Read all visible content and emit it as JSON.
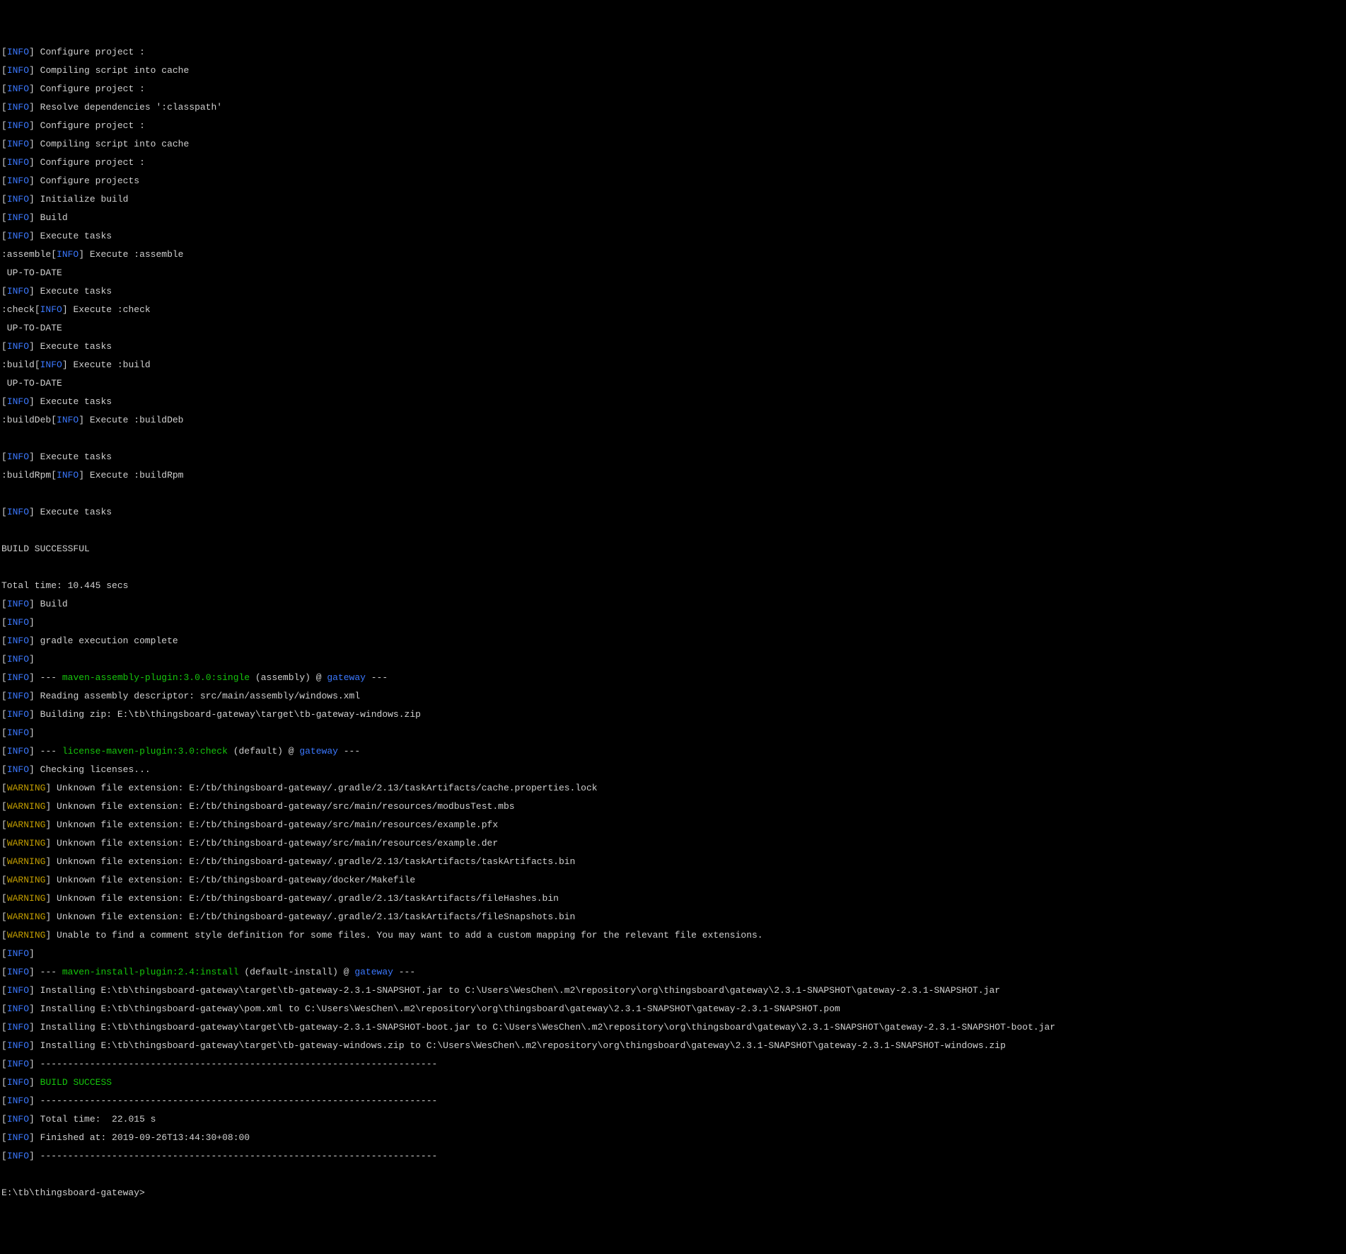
{
  "tags": {
    "info": "INFO",
    "warning": "WARNING"
  },
  "lines": {
    "l01": " Configure project :",
    "l02": " Compiling script into cache",
    "l03": " Configure project :",
    "l04": " Resolve dependencies ':classpath'",
    "l05": " Configure project :",
    "l06": " Compiling script into cache",
    "l07": " Configure project :",
    "l08": " Configure projects",
    "l09": " Initialize build",
    "l10": " Build",
    "l11": " Execute tasks",
    "l12a": ":assemble",
    "l12b": " Execute :assemble",
    "l13": " UP-TO-DATE",
    "l14": " Execute tasks",
    "l15a": ":check",
    "l15b": " Execute :check",
    "l16": " UP-TO-DATE",
    "l17": " Execute tasks",
    "l18a": ":build",
    "l18b": " Execute :build",
    "l19": " UP-TO-DATE",
    "l20": " Execute tasks",
    "l21a": ":buildDeb",
    "l21b": " Execute :buildDeb",
    "l22": " Execute tasks",
    "l23a": ":buildRpm",
    "l23b": " Execute :buildRpm",
    "l24": " Execute tasks",
    "l25": "BUILD SUCCESSFUL",
    "l26": "Total time: 10.445 secs",
    "l27": " Build",
    "l28": " gradle execution complete",
    "l29a": " --- ",
    "l29b": "maven-assembly-plugin:3.0.0:single",
    "l29c": " (assembly) @ ",
    "l29d": "gateway",
    "l29e": " ---",
    "l30": " Reading assembly descriptor: src/main/assembly/windows.xml",
    "l31": " Building zip: E:\\tb\\thingsboard-gateway\\target\\tb-gateway-windows.zip",
    "l32a": " --- ",
    "l32b": "license-maven-plugin:3.0:check",
    "l32c": " (default) @ ",
    "l32d": "gateway",
    "l32e": " ---",
    "l33": " Checking licenses...",
    "w01": " Unknown file extension: E:/tb/thingsboard-gateway/.gradle/2.13/taskArtifacts/cache.properties.lock",
    "w02": " Unknown file extension: E:/tb/thingsboard-gateway/src/main/resources/modbusTest.mbs",
    "w03": " Unknown file extension: E:/tb/thingsboard-gateway/src/main/resources/example.pfx",
    "w04": " Unknown file extension: E:/tb/thingsboard-gateway/src/main/resources/example.der",
    "w05": " Unknown file extension: E:/tb/thingsboard-gateway/.gradle/2.13/taskArtifacts/taskArtifacts.bin",
    "w06": " Unknown file extension: E:/tb/thingsboard-gateway/docker/Makefile",
    "w07": " Unknown file extension: E:/tb/thingsboard-gateway/.gradle/2.13/taskArtifacts/fileHashes.bin",
    "w08": " Unknown file extension: E:/tb/thingsboard-gateway/.gradle/2.13/taskArtifacts/fileSnapshots.bin",
    "w09": " Unable to find a comment style definition for some files. You may want to add a custom mapping for the relevant file extensions.",
    "l34a": " --- ",
    "l34b": "maven-install-plugin:2.4:install",
    "l34c": " (default-install) @ ",
    "l34d": "gateway",
    "l34e": " ---",
    "l35": " Installing E:\\tb\\thingsboard-gateway\\target\\tb-gateway-2.3.1-SNAPSHOT.jar to C:\\Users\\WesChen\\.m2\\repository\\org\\thingsboard\\gateway\\2.3.1-SNAPSHOT\\gateway-2.3.1-SNAPSHOT.jar",
    "l36": " Installing E:\\tb\\thingsboard-gateway\\pom.xml to C:\\Users\\WesChen\\.m2\\repository\\org\\thingsboard\\gateway\\2.3.1-SNAPSHOT\\gateway-2.3.1-SNAPSHOT.pom",
    "l37": " Installing E:\\tb\\thingsboard-gateway\\target\\tb-gateway-2.3.1-SNAPSHOT-boot.jar to C:\\Users\\WesChen\\.m2\\repository\\org\\thingsboard\\gateway\\2.3.1-SNAPSHOT\\gateway-2.3.1-SNAPSHOT-boot.jar",
    "l38": " Installing E:\\tb\\thingsboard-gateway\\target\\tb-gateway-windows.zip to C:\\Users\\WesChen\\.m2\\repository\\org\\thingsboard\\gateway\\2.3.1-SNAPSHOT\\gateway-2.3.1-SNAPSHOT-windows.zip",
    "dash": " ------------------------------------------------------------------------",
    "buildSuccess": " BUILD SUCCESS",
    "totalTime": " Total time:  22.015 s",
    "finishedAt": " Finished at: 2019-09-26T13:44:30+08:00",
    "prompt": "E:\\tb\\thingsboard-gateway>"
  }
}
